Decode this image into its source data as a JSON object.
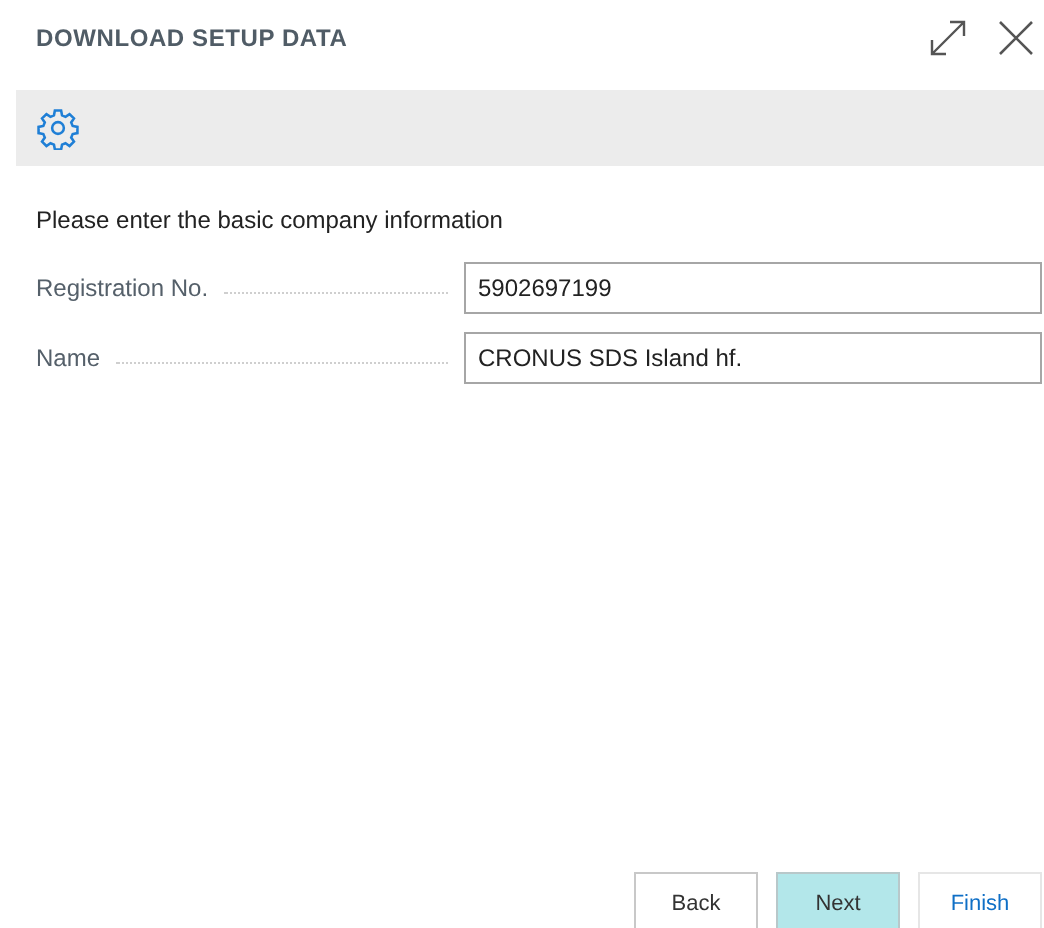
{
  "window": {
    "title": "DOWNLOAD SETUP DATA"
  },
  "instruction": "Please enter the basic company information",
  "fields": [
    {
      "label": "Registration No.",
      "value": "5902697199"
    },
    {
      "label": "Name",
      "value": "CRONUS SDS Island hf."
    }
  ],
  "buttons": [
    {
      "label": "Back",
      "kind": "secondary"
    },
    {
      "label": "Next",
      "kind": "primary"
    },
    {
      "label": "Finish",
      "kind": "link"
    }
  ]
}
